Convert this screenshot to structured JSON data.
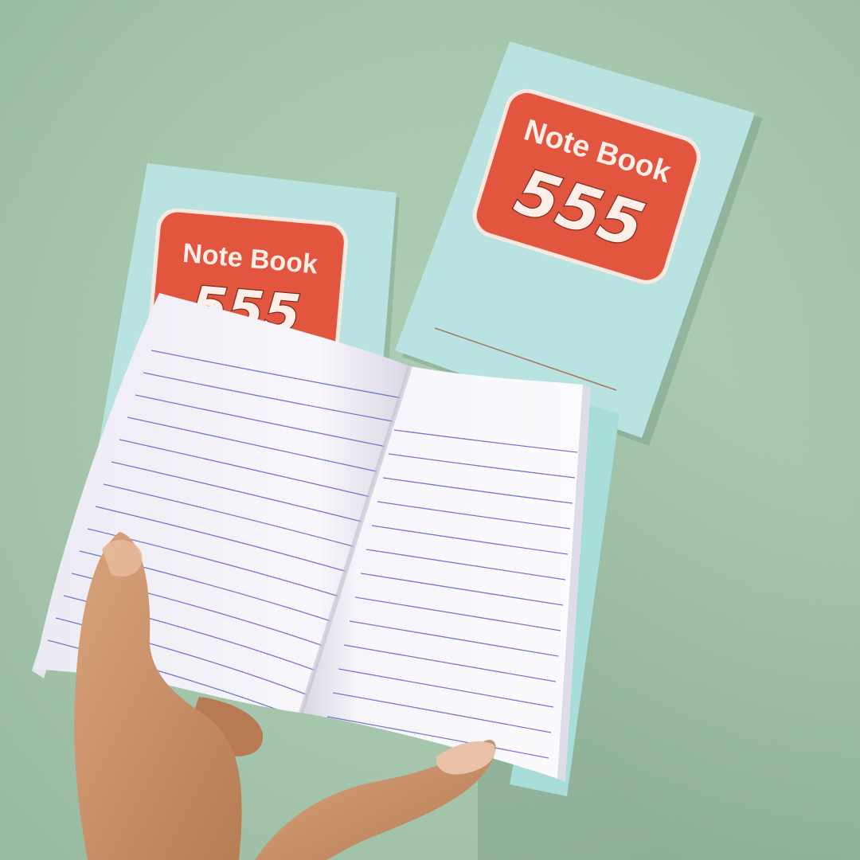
{
  "scene": {
    "description_colors": {
      "wall": "#a6c8ae",
      "cover": "#b7e3e2",
      "label": "#e2563f",
      "page": "#f7f6fb",
      "rule_line": "#5a63c8"
    }
  },
  "notebook_back_right": {
    "title": "Note Book",
    "number": "555"
  },
  "notebook_back_left": {
    "title": "Note Book",
    "number": "555"
  }
}
